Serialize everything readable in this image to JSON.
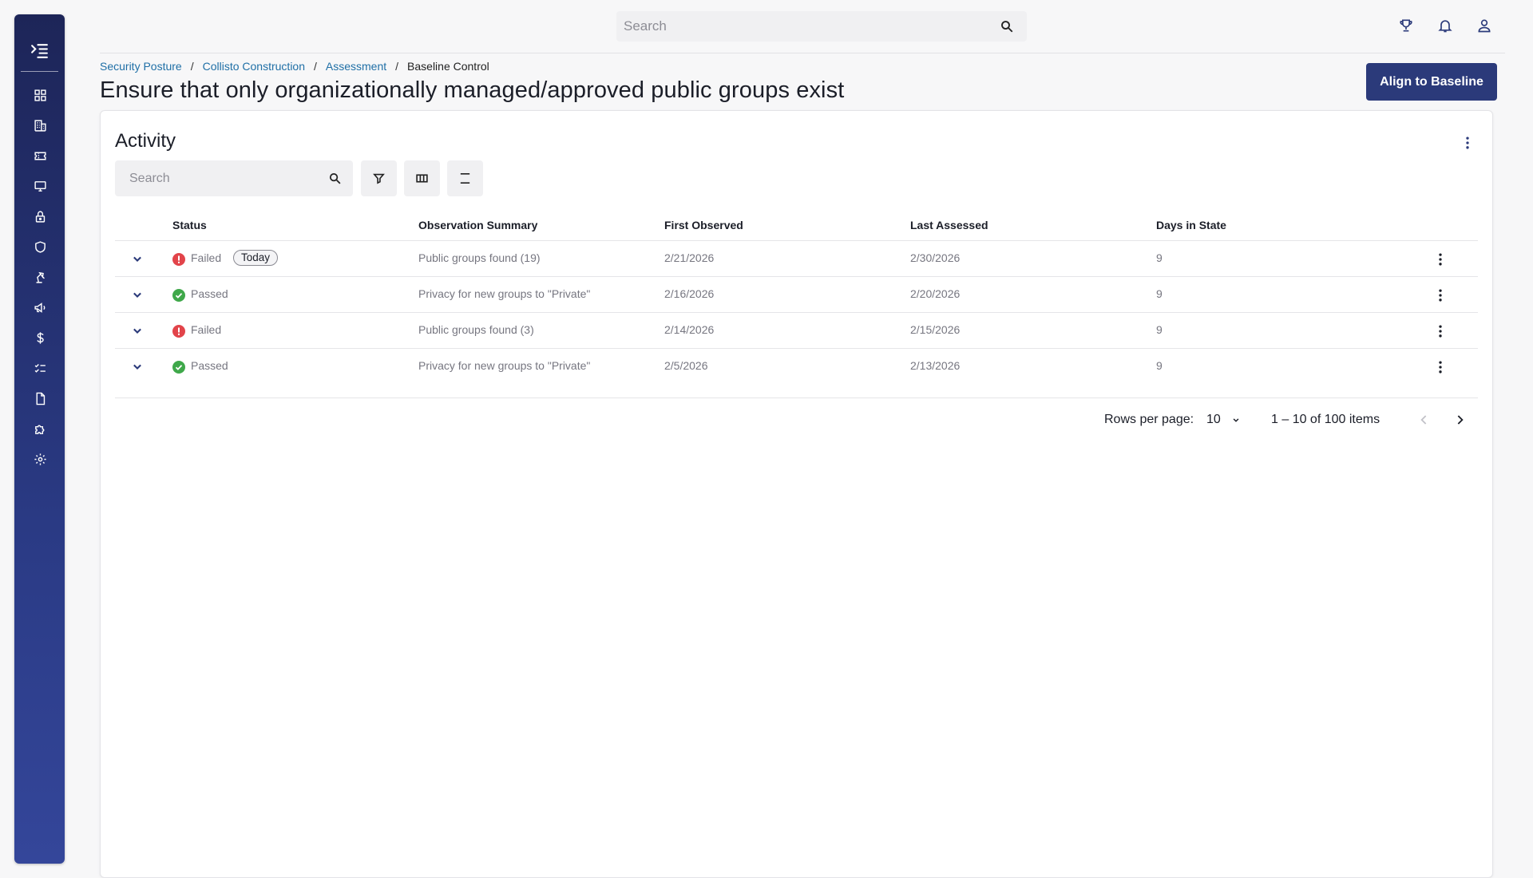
{
  "top_search": {
    "placeholder": "Search"
  },
  "sidebar": {
    "items": [
      {
        "icon": "dashboard-icon"
      },
      {
        "icon": "building-icon"
      },
      {
        "icon": "ticket-icon"
      },
      {
        "icon": "monitor-icon"
      },
      {
        "icon": "lock-icon"
      },
      {
        "icon": "shield-icon"
      },
      {
        "icon": "desk-lamp-icon"
      },
      {
        "icon": "megaphone-icon"
      },
      {
        "icon": "dollar-icon"
      },
      {
        "icon": "checklist-icon"
      },
      {
        "icon": "document-icon"
      },
      {
        "icon": "puzzle-icon"
      },
      {
        "icon": "settings-icon"
      }
    ]
  },
  "topbar_icons": [
    "trophy-icon",
    "bell-icon",
    "user-icon"
  ],
  "breadcrumb": [
    {
      "label": "Security Posture"
    },
    {
      "label": "Collisto Construction"
    },
    {
      "label": "Assessment"
    },
    {
      "label": "Baseline Control"
    }
  ],
  "page": {
    "title": "Ensure that only organizationally managed/approved public groups exist",
    "primary_action": "Align to Baseline"
  },
  "activity": {
    "title": "Activity",
    "search_placeholder": "Search",
    "columns": [
      "Status",
      "Observation Summary",
      "First Observed",
      "Last Assessed",
      "Days in State"
    ],
    "rows": [
      {
        "status": "Failed",
        "badge": "Today",
        "summary": "Public groups found (19)",
        "first_observed": "2/21/2026",
        "last_assessed": "2/30/2026",
        "days": "9"
      },
      {
        "status": "Passed",
        "badge": "",
        "summary": "Privacy for new groups to \"Private\"",
        "first_observed": "2/16/2026",
        "last_assessed": "2/20/2026",
        "days": "9"
      },
      {
        "status": "Failed",
        "badge": "",
        "summary": "Public groups found (3)",
        "first_observed": "2/14/2026",
        "last_assessed": "2/15/2026",
        "days": "9"
      },
      {
        "status": "Passed",
        "badge": "",
        "summary": "Privacy for new groups to \"Private\"",
        "first_observed": "2/5/2026",
        "last_assessed": "2/13/2026",
        "days": "9"
      }
    ],
    "pagination": {
      "rows_per_page_label": "Rows per page:",
      "rows_per_page": "10",
      "range": "1 – 10 of 100 items"
    }
  },
  "colors": {
    "sidebar_top": "#1d2558",
    "sidebar_bottom": "#34469a",
    "primary_button": "#2b3a7a",
    "link": "#1f6fa6",
    "failed": "#e2444a",
    "passed": "#3fa84a"
  }
}
